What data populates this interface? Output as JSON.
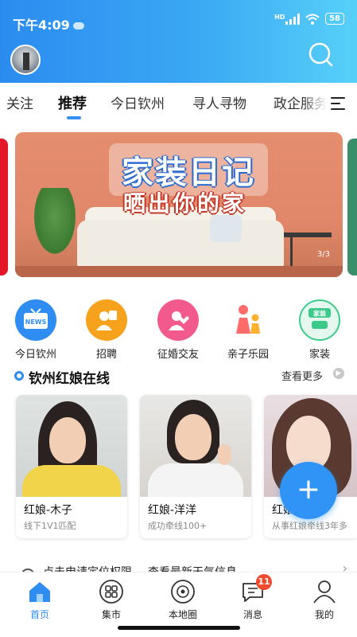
{
  "status_bar": {
    "time": "下午4:09",
    "network": "HD",
    "battery": "58"
  },
  "tabs": [
    {
      "label": "关注",
      "active": false
    },
    {
      "label": "推荐",
      "active": true
    },
    {
      "label": "今日钦州",
      "active": false
    },
    {
      "label": "寻人寻物",
      "active": false
    },
    {
      "label": "政企服务",
      "active": false
    }
  ],
  "banner": {
    "title": "家装日记",
    "subtitle": "晒出你的家",
    "page_indicator": "3/3"
  },
  "quick_icons": [
    {
      "label": "今日钦州",
      "icon": "news-tv-icon",
      "color": "#2f8cf0",
      "text": "NEWS"
    },
    {
      "label": "招聘",
      "icon": "recruit-icon",
      "color": "#f6a21c"
    },
    {
      "label": "征婚交友",
      "icon": "dating-icon",
      "color": "#f25a8e"
    },
    {
      "label": "亲子乐园",
      "icon": "family-icon",
      "color": "#ff6b6b"
    },
    {
      "label": "家装",
      "icon": "home-decor-icon",
      "color": "#3cc98a",
      "text": "家装"
    }
  ],
  "matchmaker": {
    "title": "钦州红娘在线",
    "more": "查看更多",
    "cards": [
      {
        "name": "红娘-木子",
        "desc": "线下1V1匹配"
      },
      {
        "name": "红娘-洋洋",
        "desc": "成功牵线100+"
      },
      {
        "name": "红娘-",
        "desc": "从事红娘牵线3年多"
      }
    ]
  },
  "fab": {
    "label": "+"
  },
  "location_bar": {
    "text1": "点击申请定位权限",
    "text2": "查看最新天气信息"
  },
  "bottom_nav": [
    {
      "label": "首页",
      "icon": "home-icon",
      "active": true
    },
    {
      "label": "集市",
      "icon": "market-icon",
      "active": false
    },
    {
      "label": "本地圈",
      "icon": "local-circle-icon",
      "active": false
    },
    {
      "label": "消息",
      "icon": "message-icon",
      "active": false,
      "badge": "11"
    },
    {
      "label": "我的",
      "icon": "profile-icon",
      "active": false
    }
  ]
}
